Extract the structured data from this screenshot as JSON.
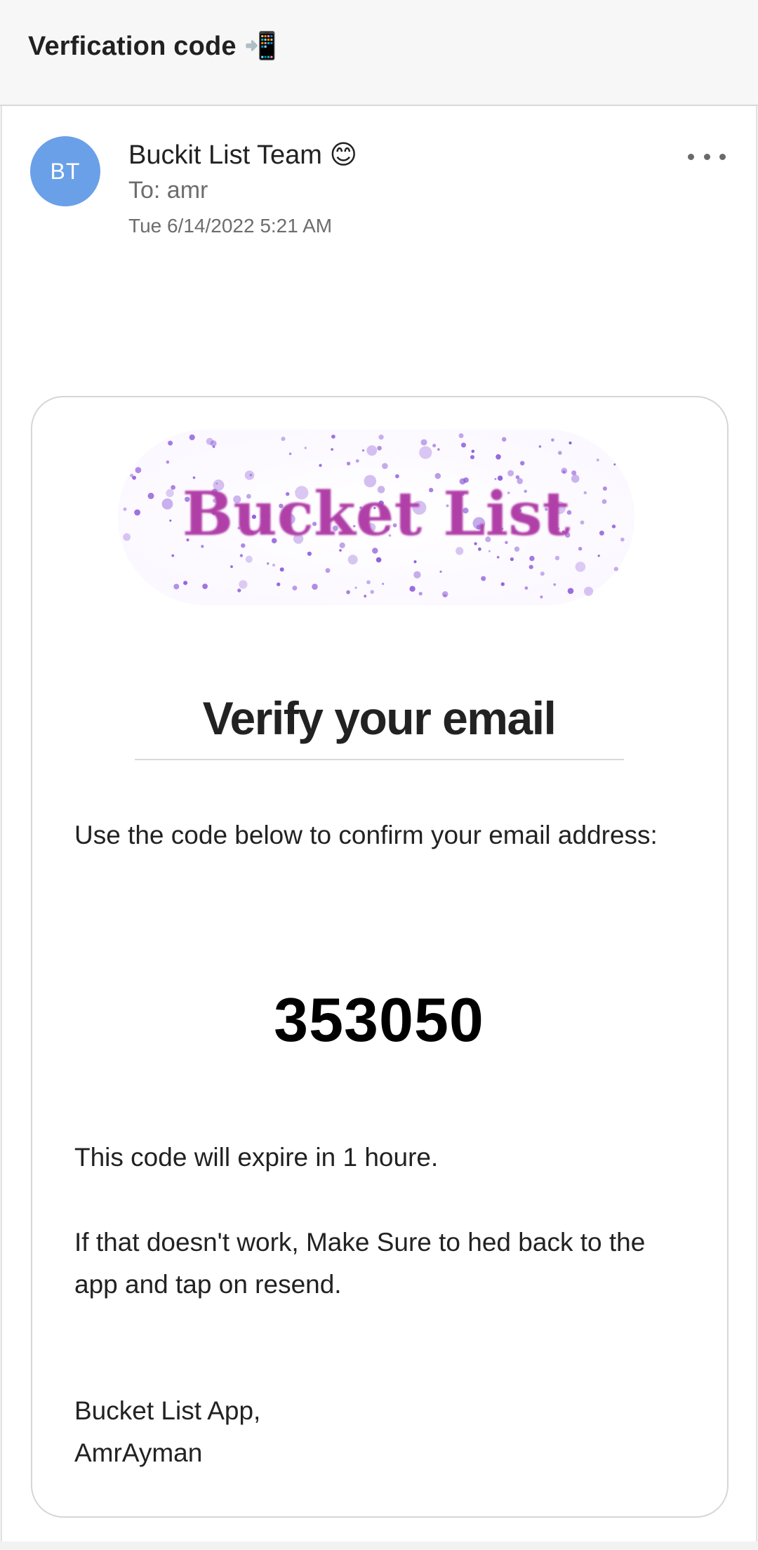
{
  "header": {
    "subject": "Verfication code",
    "subject_emoji": "📲"
  },
  "message": {
    "avatar_initials": "BT",
    "sender": "Buckit List Team 😊",
    "to": "To: amr",
    "date": "Tue 6/14/2022 5:21 AM",
    "more_icon": "more-horizontal-icon"
  },
  "body": {
    "logo_text": "Bucket List",
    "heading": "Verify your email",
    "instruction": "Use the code below to confirm your email address:",
    "code": "353050",
    "expiry": "This code will expire in 1 houre.",
    "fallback": "If that doesn't work, Make Sure to hed back to the app and tap on resend.",
    "signature_line1": "Bucket List App,",
    "signature_line2": "AmrAyman"
  },
  "colors": {
    "avatar": "#6aa0e8",
    "logo_text": "#b040a8",
    "logo_dots": "#8a55d8"
  }
}
